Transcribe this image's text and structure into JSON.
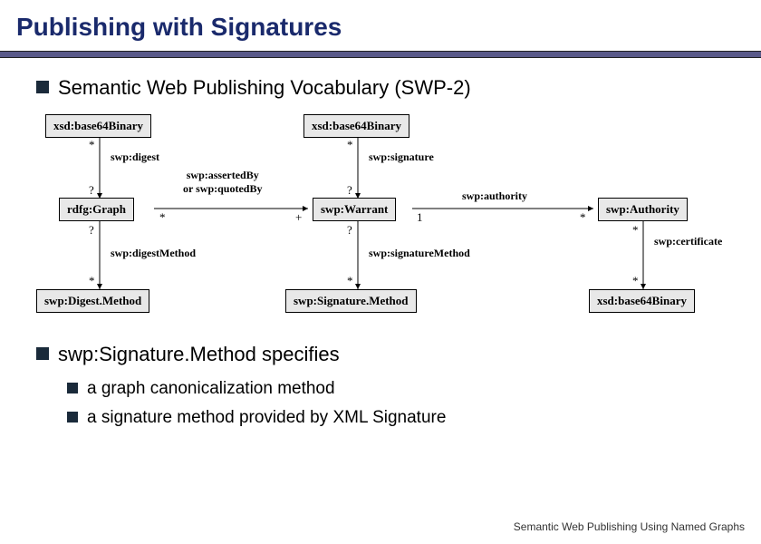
{
  "title": "Publishing with Signatures",
  "bullets": {
    "b1": "Semantic Web Publishing Vocabulary (SWP-2)",
    "b2": "swp:Signature.Method specifies",
    "b2a": "a graph canonicalization method",
    "b2b": "a signature method provided by XML Signature"
  },
  "diagram": {
    "nodes": {
      "xsd_base64_left": "xsd:base64Binary",
      "rdfg_graph": "rdfg:Graph",
      "swp_digestmethod": "swp:Digest.Method",
      "xsd_base64_mid": "xsd:base64Binary",
      "swp_warrant": "swp:Warrant",
      "swp_sigmethod": "swp:Signature.Method",
      "swp_authority": "swp:Authority",
      "xsd_base64_right": "xsd:base64Binary"
    },
    "edges": {
      "swp_digest": "swp:digest",
      "swp_digestmethod_lbl": "swp:digestMethod",
      "asserted_quoted": "swp:assertedBy\nor swp:quotedBy",
      "swp_signature": "swp:signature",
      "swp_sigmethod_lbl": "swp:signatureMethod",
      "swp_authority_lbl": "swp:authority",
      "swp_certificate": "swp:certificate"
    },
    "cards": {
      "star": "*",
      "qmark": "?",
      "plus": "+",
      "one": "1"
    }
  },
  "footer": "Semantic Web Publishing Using Named Graphs"
}
